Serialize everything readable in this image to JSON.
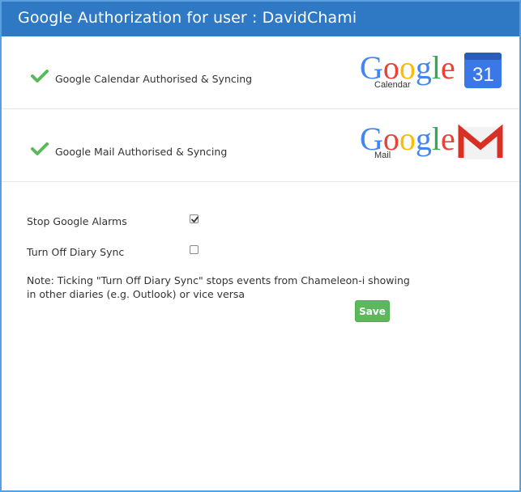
{
  "header": {
    "title": "Google Authorization for user : DavidChami"
  },
  "services": [
    {
      "label": "Google Calendar Authorised & Syncing",
      "logo_word": "Google",
      "logo_sub": "Calendar",
      "badge_text": "31"
    },
    {
      "label": "Google Mail Authorised & Syncing",
      "logo_word": "Google",
      "logo_sub": "Mail",
      "badge_text": "M"
    }
  ],
  "options": {
    "stop_alarms": {
      "label": "Stop Google Alarms",
      "checked": true
    },
    "diary_sync": {
      "label": "Turn Off Diary Sync",
      "checked": false
    }
  },
  "note": {
    "line1": "Note: Ticking \"Turn Off Diary Sync\" stops events from Chameleon-i showing",
    "line2": "in other diaries (e.g. Outlook) or vice versa"
  },
  "save_label": "Save",
  "colors": {
    "header_bg": "#2f78c4",
    "border": "#5aa0e0",
    "check_green": "#5cb85c",
    "save_green": "#5cb85c",
    "google_blue": "#4285f4",
    "google_red": "#ea4335",
    "google_yellow": "#fbbc05",
    "google_green": "#34a853"
  },
  "icons": [
    "check-icon",
    "google-calendar-logo",
    "google-mail-logo",
    "checkbox-checked-icon"
  ]
}
